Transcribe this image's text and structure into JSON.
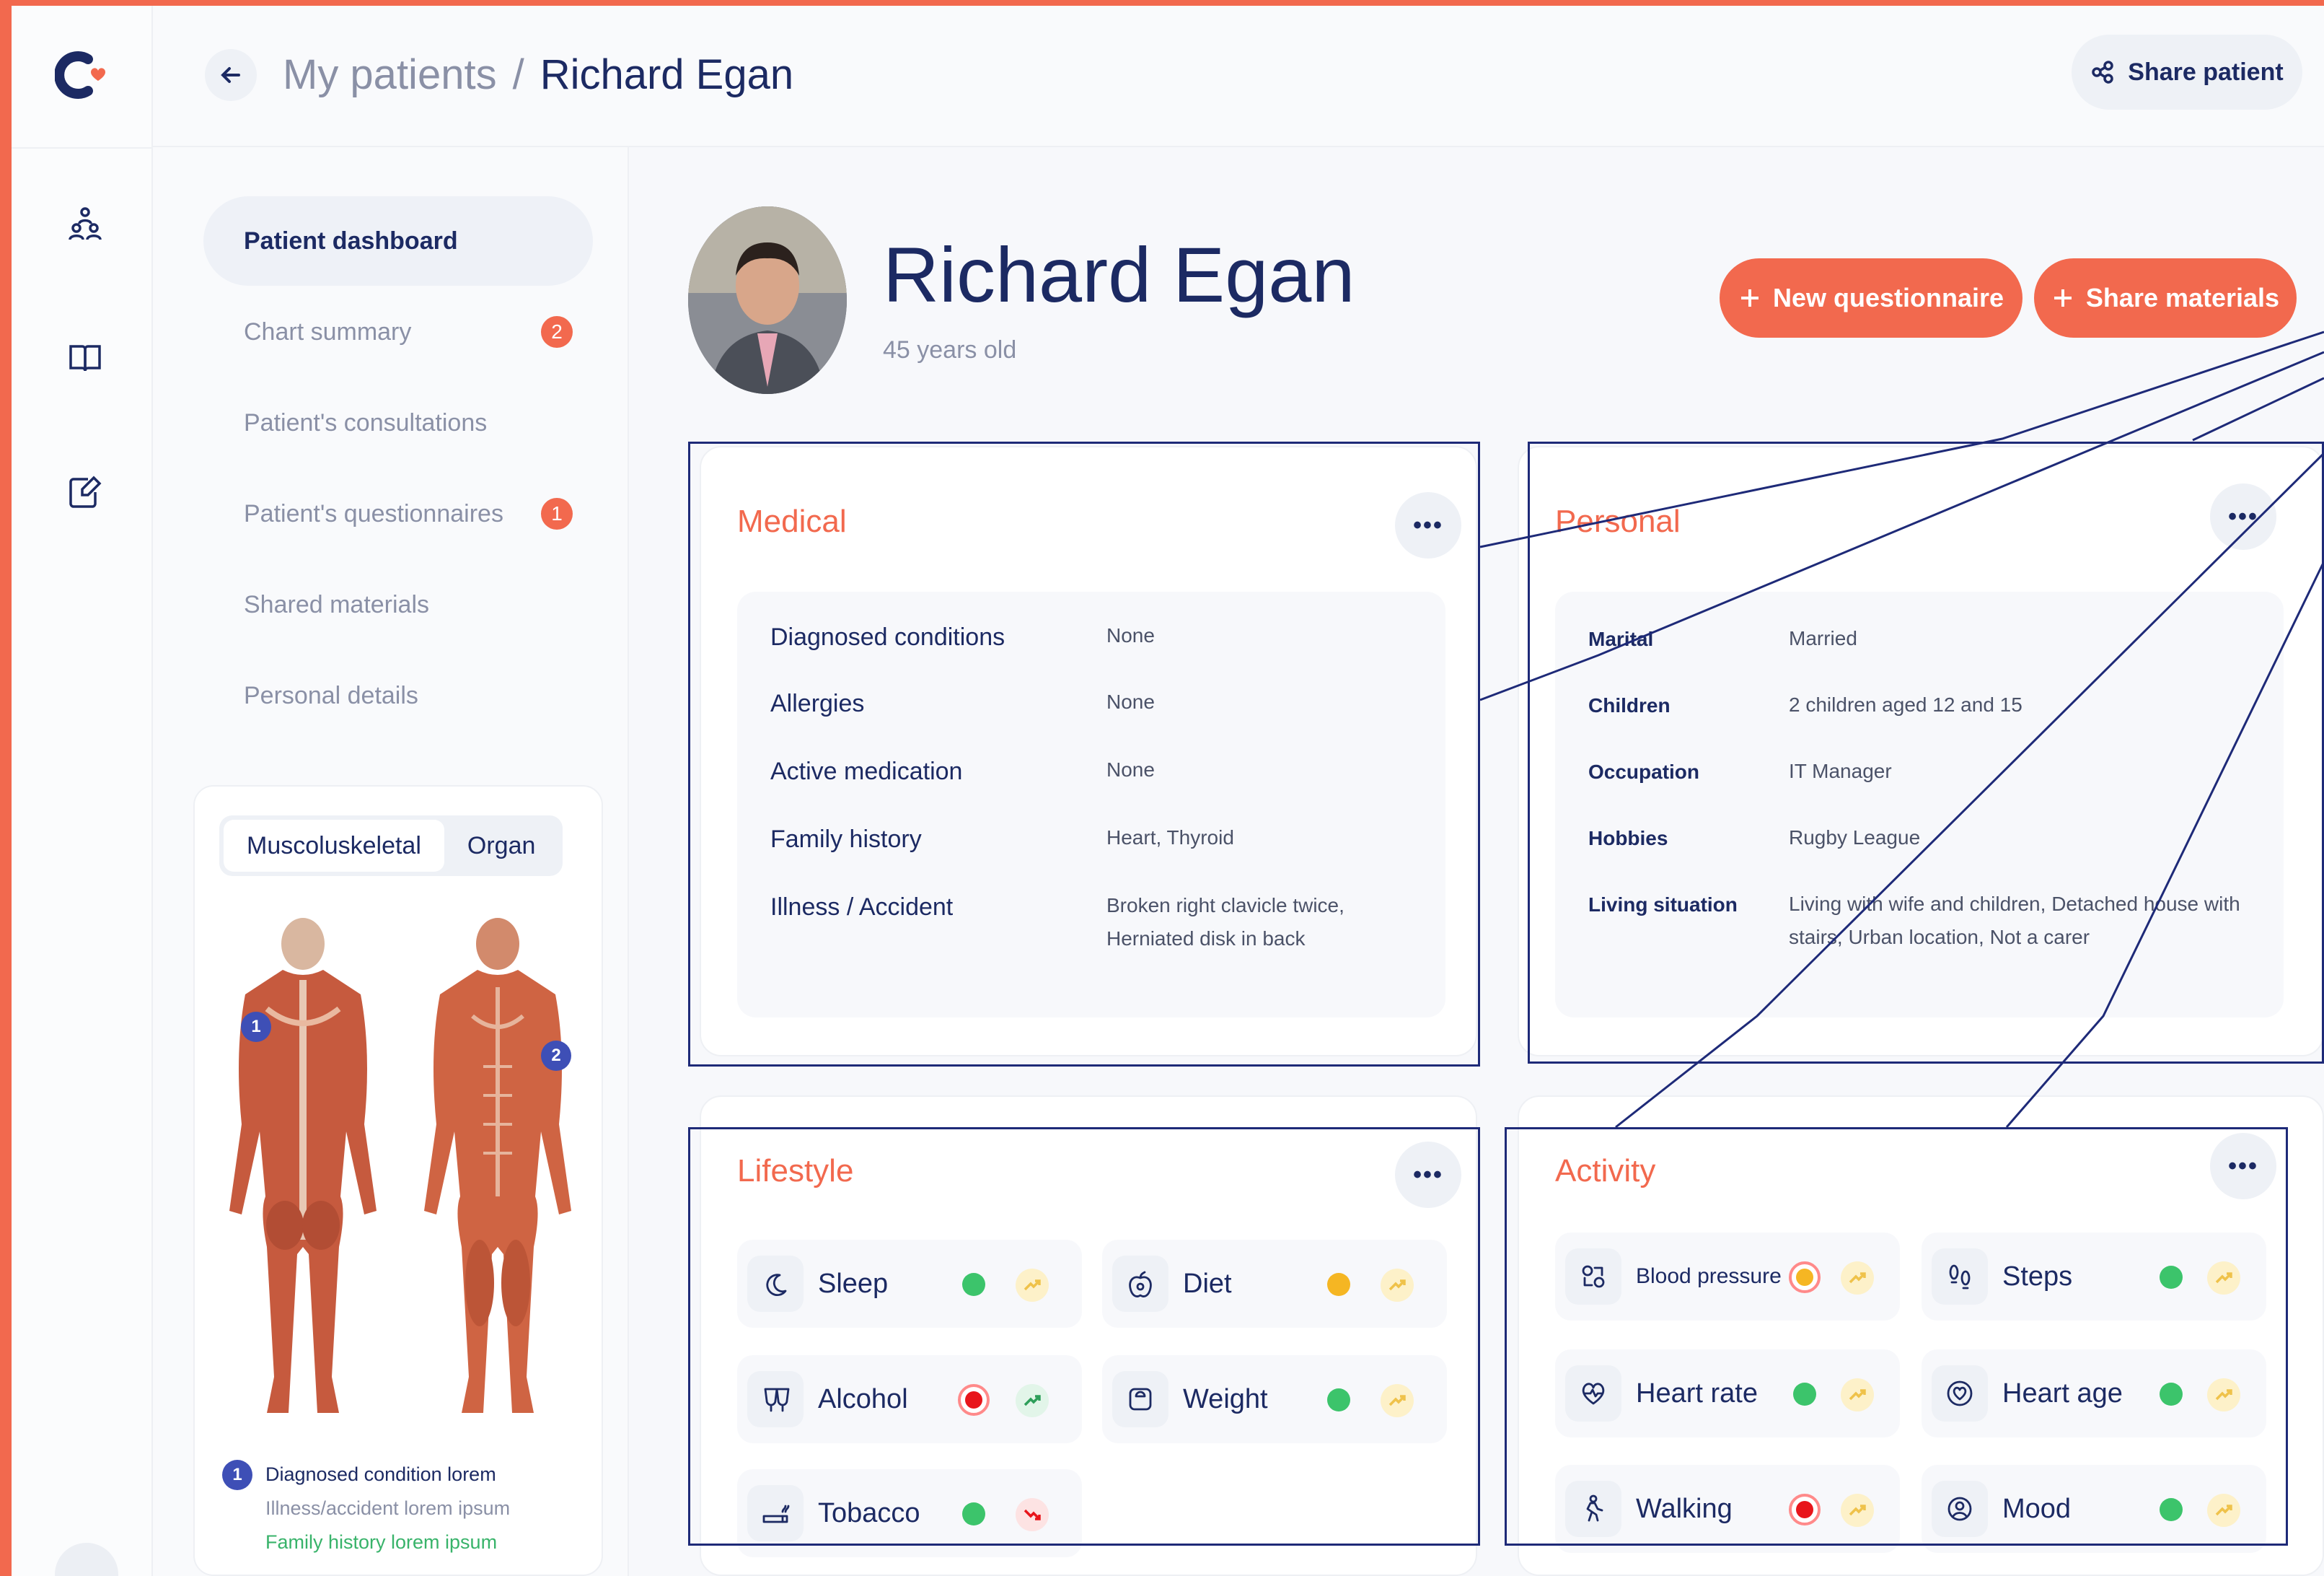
{
  "header": {
    "breadcrumb_root": "My patients",
    "breadcrumb_separator": "/",
    "breadcrumb_current": "Richard Egan",
    "share_patient_label": "Share patient"
  },
  "nav": {
    "items": [
      {
        "label": "Patient dashboard",
        "badge": ""
      },
      {
        "label": "Chart summary",
        "badge": "2"
      },
      {
        "label": "Patient's consultations",
        "badge": ""
      },
      {
        "label": "Patient's questionnaires",
        "badge": "1"
      },
      {
        "label": "Shared materials",
        "badge": ""
      },
      {
        "label": "Personal details",
        "badge": ""
      }
    ]
  },
  "body_map": {
    "tabs": [
      "Muscoluskeletal",
      "Organ"
    ],
    "markers": [
      "1",
      "2"
    ],
    "legend": {
      "marker": "1",
      "line1": "Diagnosed condition lorem",
      "line2": "Illness/accident lorem ipsum",
      "line3": "Family history lorem ipsum"
    }
  },
  "patient": {
    "name": "Richard Egan",
    "age": "45 years old"
  },
  "actions": {
    "new_questionnaire": "New questionnaire",
    "share_materials": "Share materials"
  },
  "medical": {
    "title": "Medical",
    "more": "•••",
    "rows": [
      {
        "key": "Diagnosed conditions",
        "value": "None"
      },
      {
        "key": "Allergies",
        "value": "None"
      },
      {
        "key": "Active medication",
        "value": "None"
      },
      {
        "key": "Family history",
        "value": "Heart, Thyroid"
      },
      {
        "key": "Illness / Accident",
        "value": "Broken right clavicle twice, Herniated disk in back"
      }
    ]
  },
  "personal": {
    "title": "Personal",
    "more": "•••",
    "rows": [
      {
        "key": "Marital",
        "value": "Married"
      },
      {
        "key": "Children",
        "value": "2 children aged 12 and 15"
      },
      {
        "key": "Occupation",
        "value": "IT Manager"
      },
      {
        "key": "Hobbies",
        "value": "Rugby League"
      },
      {
        "key": "Living situation",
        "value": "Living with wife and children, Detached house with stairs, Urban location, Not a carer"
      }
    ]
  },
  "lifestyle": {
    "title": "Lifestyle",
    "more": "•••",
    "items": [
      {
        "label": "Sleep",
        "icon": "moon-icon",
        "status": "#3cc46b",
        "trend": "up"
      },
      {
        "label": "Diet",
        "icon": "apple-icon",
        "status": "#f5b623",
        "trend": "up"
      },
      {
        "label": "Alcohol",
        "icon": "glasses-icon",
        "status": "#e8151b",
        "trend": "up-green"
      },
      {
        "label": "Weight",
        "icon": "scale-icon",
        "status": "#3cc46b",
        "trend": "up"
      },
      {
        "label": "Tobacco",
        "icon": "cigarette-icon",
        "status": "#3cc46b",
        "trend": "down-red"
      }
    ]
  },
  "activity": {
    "title": "Activity",
    "more": "•••",
    "items": [
      {
        "label": "Blood pressure",
        "icon": "pressure-icon",
        "status": "#f5b623",
        "ring": true,
        "trend": "up"
      },
      {
        "label": "Steps",
        "icon": "footsteps-icon",
        "status": "#3cc46b",
        "trend": "up"
      },
      {
        "label": "Heart rate",
        "icon": "heart-pulse-icon",
        "status": "#3cc46b",
        "trend": "up"
      },
      {
        "label": "Heart age",
        "icon": "heart-icon",
        "status": "#3cc46b",
        "trend": "up"
      },
      {
        "label": "Walking",
        "icon": "walking-icon",
        "status": "#e8151b",
        "trend": "up"
      },
      {
        "label": "Mood",
        "icon": "smile-icon",
        "status": "#3cc46b",
        "trend": "up"
      }
    ]
  },
  "colors": {
    "accent": "#f2694e",
    "navy": "#1c2a63",
    "callout": "#1e2a78"
  }
}
